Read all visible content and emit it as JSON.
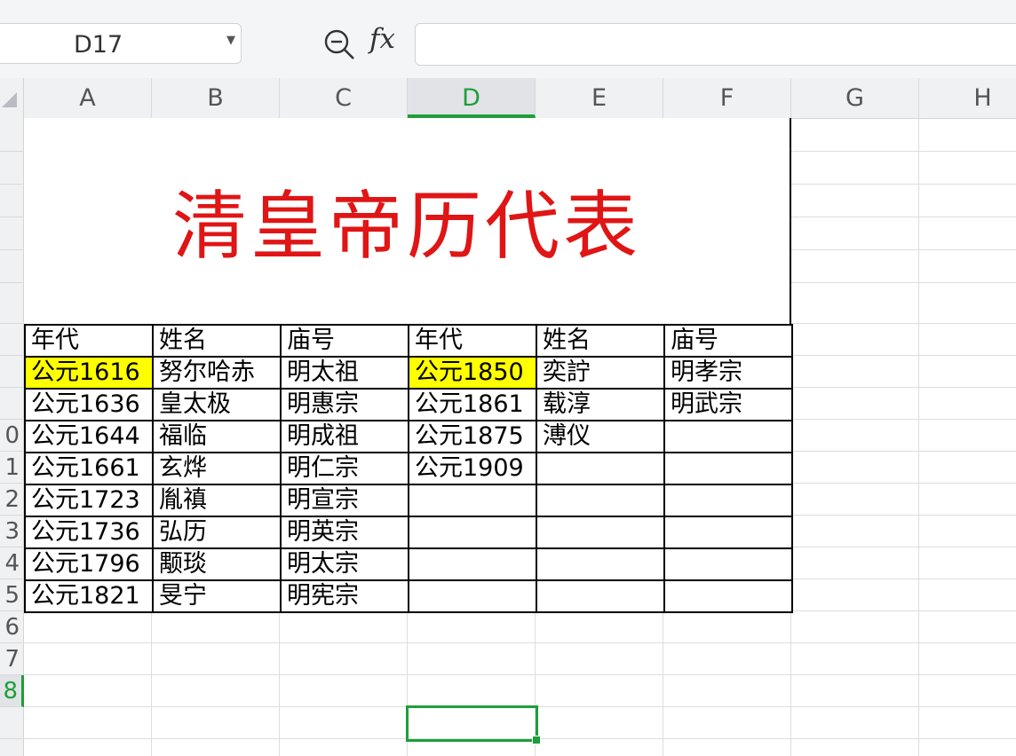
{
  "formula_bar": {
    "name_box": "D17",
    "fx_label": "fx",
    "formula_value": ""
  },
  "columns": [
    "A",
    "B",
    "C",
    "D",
    "E",
    "F",
    "G",
    "H"
  ],
  "rows": [
    "",
    "",
    "",
    "",
    "",
    "",
    "",
    "",
    "",
    "0",
    "1",
    "2",
    "3",
    "4",
    "5",
    "6",
    "7",
    "8"
  ],
  "active_cell": {
    "column": "D",
    "row": "7"
  },
  "title": "清皇帝历代表",
  "table": {
    "header": [
      "年代",
      "姓名",
      "庙号",
      "年代",
      "姓名",
      "庙号"
    ],
    "rows": [
      [
        "公元1616",
        "努尔哈赤",
        "明太祖",
        "公元1850",
        "奕詝",
        "明孝宗"
      ],
      [
        "公元1636",
        "皇太极",
        "明惠宗",
        "公元1861",
        "载淳",
        "明武宗"
      ],
      [
        "公元1644",
        "福临",
        "明成祖",
        "公元1875",
        "溥仪",
        ""
      ],
      [
        "公元1661",
        "玄烨",
        "明仁宗",
        "公元1909",
        "",
        ""
      ],
      [
        "公元1723",
        "胤禛",
        "明宣宗",
        "",
        "",
        ""
      ],
      [
        "公元1736",
        "弘历",
        "明英宗",
        "",
        "",
        ""
      ],
      [
        "公元1796",
        "颙琰",
        "明太宗",
        "",
        "",
        ""
      ],
      [
        "公元1821",
        "旻宁",
        "明宪宗",
        "",
        "",
        ""
      ]
    ]
  },
  "colors": {
    "title_color": "#e01515",
    "highlight_fill": "#ffff00",
    "selection_green": "#1e9e3a"
  },
  "highlighted_cells": [
    "A5",
    "D5"
  ]
}
